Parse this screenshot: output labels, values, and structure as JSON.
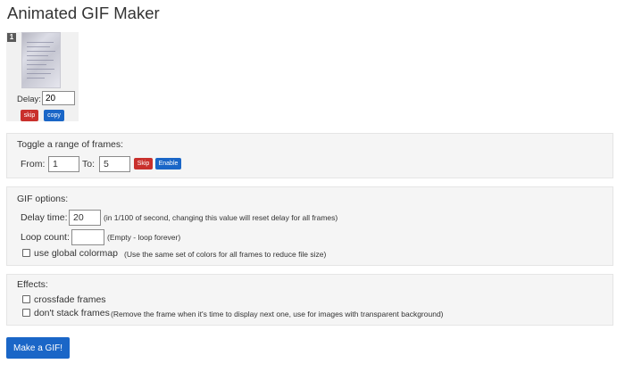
{
  "page_title": "Animated GIF Maker",
  "frame": {
    "number": "1",
    "delay_label": "Delay:",
    "delay_value": "20",
    "skip_label": "skip",
    "copy_label": "copy"
  },
  "toggle_range": {
    "heading": "Toggle a range of frames:",
    "from_label": "From:",
    "from_value": "1",
    "to_label": "To:",
    "to_value": "5",
    "skip_label": "Skip",
    "enable_label": "Enable"
  },
  "gif_options": {
    "heading": "GIF options:",
    "delay_label": "Delay time:",
    "delay_value": "20",
    "delay_note": "(in 1/100 of second, changing this value will reset delay for all frames)",
    "loop_label": "Loop count:",
    "loop_value": "",
    "loop_note": "(Empty - loop forever)",
    "colormap_label": "use global colormap",
    "colormap_note": "(Use the same set of colors for all frames to reduce file size)",
    "colormap_checked": false
  },
  "effects": {
    "heading": "Effects:",
    "crossfade_label": "crossfade frames",
    "crossfade_checked": false,
    "nostack_label": "don't stack frames",
    "nostack_note": "(Remove the frame when it's time to display next one, use for images with transparent background)",
    "nostack_checked": false
  },
  "make_button_label": "Make a GIF!",
  "colors": {
    "primary": "#1a66c7",
    "danger": "#c9302c",
    "panel": "#f5f5f5"
  }
}
